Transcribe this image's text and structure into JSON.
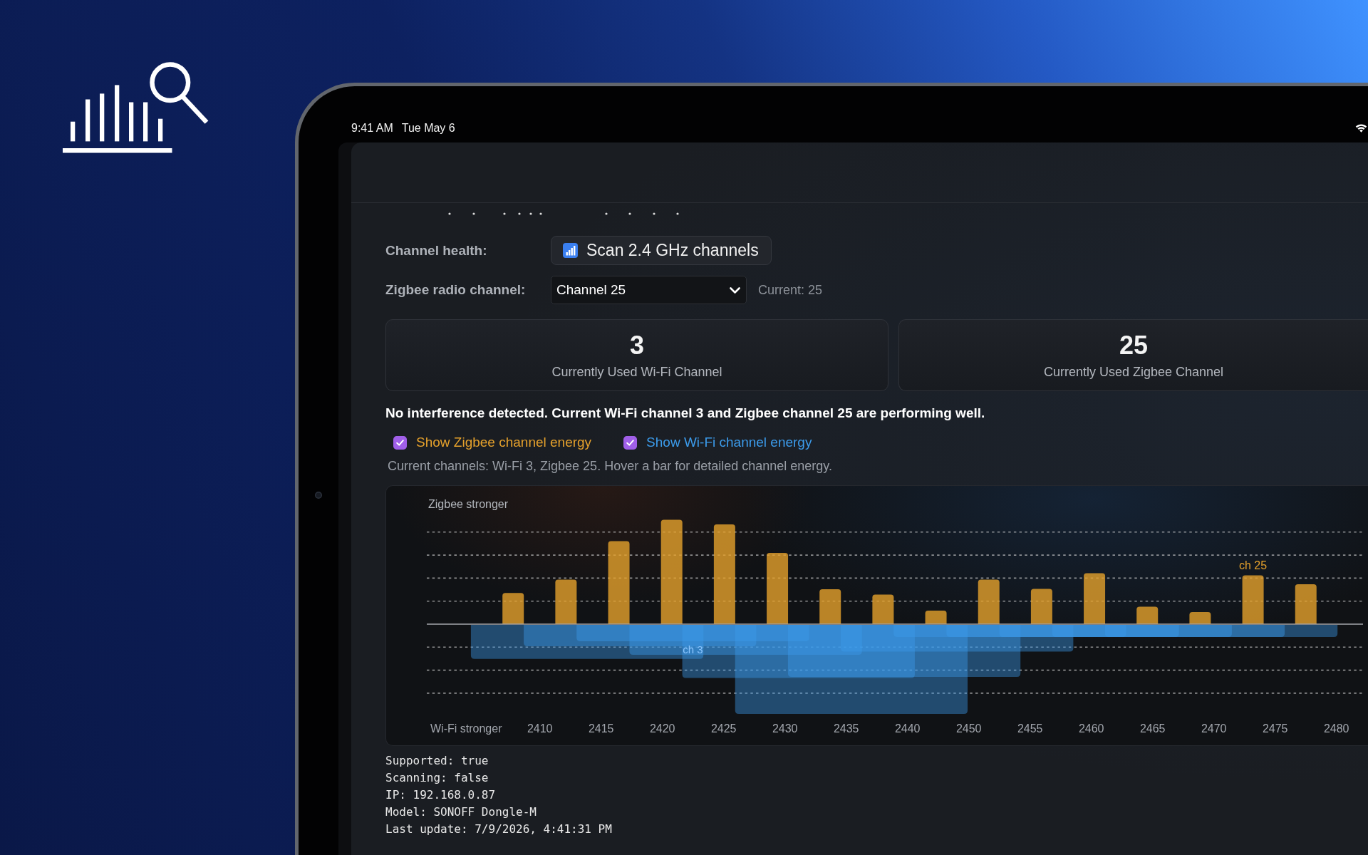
{
  "status_bar": {
    "time": "9:41 AM",
    "date": "Tue May 6"
  },
  "channel_health": {
    "label": "Channel health:",
    "button": "Scan 2.4 GHz channels"
  },
  "radio_channel": {
    "label": "Zigbee radio channel:",
    "value": "Channel 25",
    "current": "Current: 25"
  },
  "stats": [
    {
      "value": "3",
      "label": "Currently Used Wi-Fi Channel"
    },
    {
      "value": "25",
      "label": "Currently Used Zigbee Channel"
    }
  ],
  "message": "No interference detected. Current Wi-Fi channel 3 and Zigbee channel 25 are performing well.",
  "toggles": [
    {
      "label": "Show Zigbee channel energy",
      "checked": true,
      "color": "#e5a12c"
    },
    {
      "label": "Show Wi-Fi channel energy",
      "checked": true,
      "color": "#3c9cec"
    }
  ],
  "hint": "Current channels: Wi-Fi 3, Zigbee 25. Hover a bar for detailed channel energy.",
  "chart": {
    "top_caption": "Zigbee stronger",
    "bottom_caption": "Wi-Fi stronger",
    "x_labels": [
      "2410",
      "2415",
      "2420",
      "2425",
      "2430",
      "2435",
      "2440",
      "2450",
      "2455",
      "2460",
      "2465",
      "2470",
      "2475",
      "2480"
    ],
    "zigbee_marker": "ch 25",
    "wifi_marker": "ch 3"
  },
  "device_info": [
    "Supported: true",
    "Scanning: false",
    "IP: 192.168.0.87",
    "Model: SONOFF Dongle-M",
    "Last update: 7/9/2026, 4:41:31 PM"
  ]
}
